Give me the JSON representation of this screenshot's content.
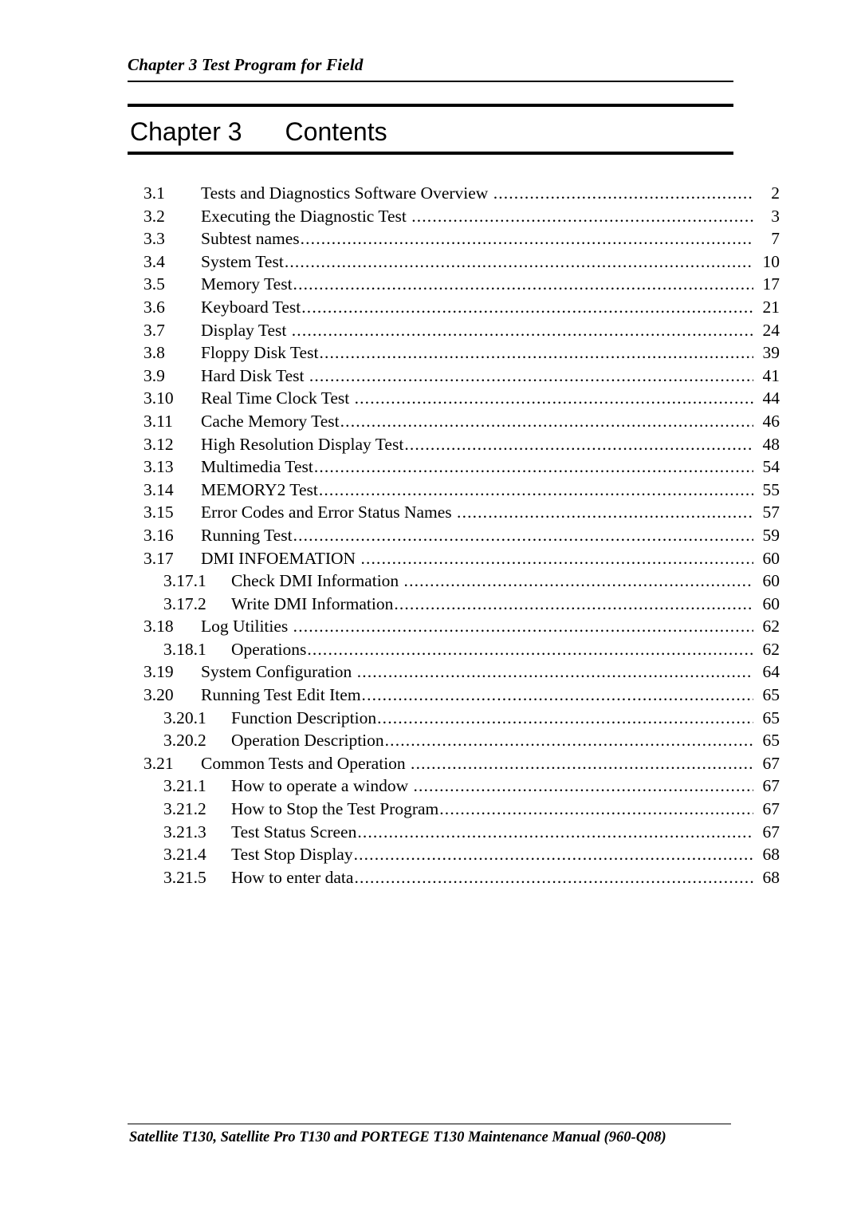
{
  "header": {
    "running_header": "Chapter 3 Test Program for Field"
  },
  "title": {
    "chapter_label": "Chapter 3",
    "title_text": "Contents"
  },
  "toc": {
    "entries": [
      {
        "number": "3.1",
        "label": "Tests and Diagnostics Software Overview",
        "page": "2",
        "level": 1,
        "space_before_dots": true
      },
      {
        "number": "3.2",
        "label": "Executing the Diagnostic Test",
        "page": "3",
        "level": 1,
        "space_before_dots": true
      },
      {
        "number": "3.3",
        "label": "Subtest names",
        "page": "7",
        "level": 1,
        "space_before_dots": false
      },
      {
        "number": "3.4",
        "label": "System Test",
        "page": "10",
        "level": 1,
        "space_before_dots": false
      },
      {
        "number": "3.5",
        "label": "Memory Test",
        "page": "17",
        "level": 1,
        "space_before_dots": false
      },
      {
        "number": "3.6",
        "label": "Keyboard Test",
        "page": "21",
        "level": 1,
        "space_before_dots": false
      },
      {
        "number": "3.7",
        "label": "Display Test",
        "page": "24",
        "level": 1,
        "space_before_dots": true
      },
      {
        "number": "3.8",
        "label": "Floppy Disk Test",
        "page": "39",
        "level": 1,
        "space_before_dots": false
      },
      {
        "number": "3.9",
        "label": "Hard Disk Test",
        "page": "41",
        "level": 1,
        "space_before_dots": true
      },
      {
        "number": "3.10",
        "label": "Real Time Clock Test",
        "page": "44",
        "level": 1,
        "space_before_dots": true
      },
      {
        "number": "3.11",
        "label": "Cache Memory Test",
        "page": "46",
        "level": 1,
        "space_before_dots": false
      },
      {
        "number": "3.12",
        "label": "High Resolution Display Test",
        "page": "48",
        "level": 1,
        "space_before_dots": false
      },
      {
        "number": "3.13",
        "label": "Multimedia Test",
        "page": "54",
        "level": 1,
        "space_before_dots": false
      },
      {
        "number": "3.14",
        "label": "MEMORY2 Test",
        "page": "55",
        "level": 1,
        "space_before_dots": false
      },
      {
        "number": "3.15",
        "label": "Error Codes and Error Status Names",
        "page": "57",
        "level": 1,
        "space_before_dots": true
      },
      {
        "number": "3.16",
        "label": "Running Test",
        "page": "59",
        "level": 1,
        "space_before_dots": false
      },
      {
        "number": "3.17",
        "label": "DMI INFOEMATION",
        "page": "60",
        "level": 1,
        "space_before_dots": true
      },
      {
        "number": "3.17.1",
        "label": "Check DMI Information",
        "page": "60",
        "level": 2,
        "space_before_dots": true
      },
      {
        "number": "3.17.2",
        "label": "Write DMI Information",
        "page": "60",
        "level": 2,
        "space_before_dots": false
      },
      {
        "number": "3.18",
        "label": "Log Utilities",
        "page": "62",
        "level": 1,
        "space_before_dots": true
      },
      {
        "number": "3.18.1",
        "label": "Operations",
        "page": "62",
        "level": 2,
        "space_before_dots": false
      },
      {
        "number": "3.19",
        "label": "System Configuration",
        "page": "64",
        "level": 1,
        "space_before_dots": true
      },
      {
        "number": "3.20",
        "label": "Running Test Edit Item",
        "page": "65",
        "level": 1,
        "space_before_dots": false
      },
      {
        "number": "3.20.1",
        "label": "Function Description",
        "page": "65",
        "level": 2,
        "space_before_dots": false
      },
      {
        "number": "3.20.2",
        "label": "Operation Description",
        "page": "65",
        "level": 2,
        "space_before_dots": false
      },
      {
        "number": "3.21",
        "label": "Common Tests and Operation",
        "page": "67",
        "level": 1,
        "space_before_dots": true
      },
      {
        "number": "3.21.1",
        "label": "How to operate a window",
        "page": "67",
        "level": 2,
        "space_before_dots": true
      },
      {
        "number": "3.21.2",
        "label": "How to Stop the Test Program",
        "page": "67",
        "level": 2,
        "space_before_dots": false
      },
      {
        "number": "3.21.3",
        "label": "Test Status Screen",
        "page": "67",
        "level": 2,
        "space_before_dots": false
      },
      {
        "number": "3.21.4",
        "label": "Test Stop Display",
        "page": "68",
        "level": 2,
        "space_before_dots": false
      },
      {
        "number": "3.21.5",
        "label": "How to enter data",
        "page": "68",
        "level": 2,
        "space_before_dots": false
      }
    ]
  },
  "footer": {
    "text": "Satellite T130, Satellite Pro T130 and PORTEGE T130 Maintenance Manual (960-Q08)"
  }
}
